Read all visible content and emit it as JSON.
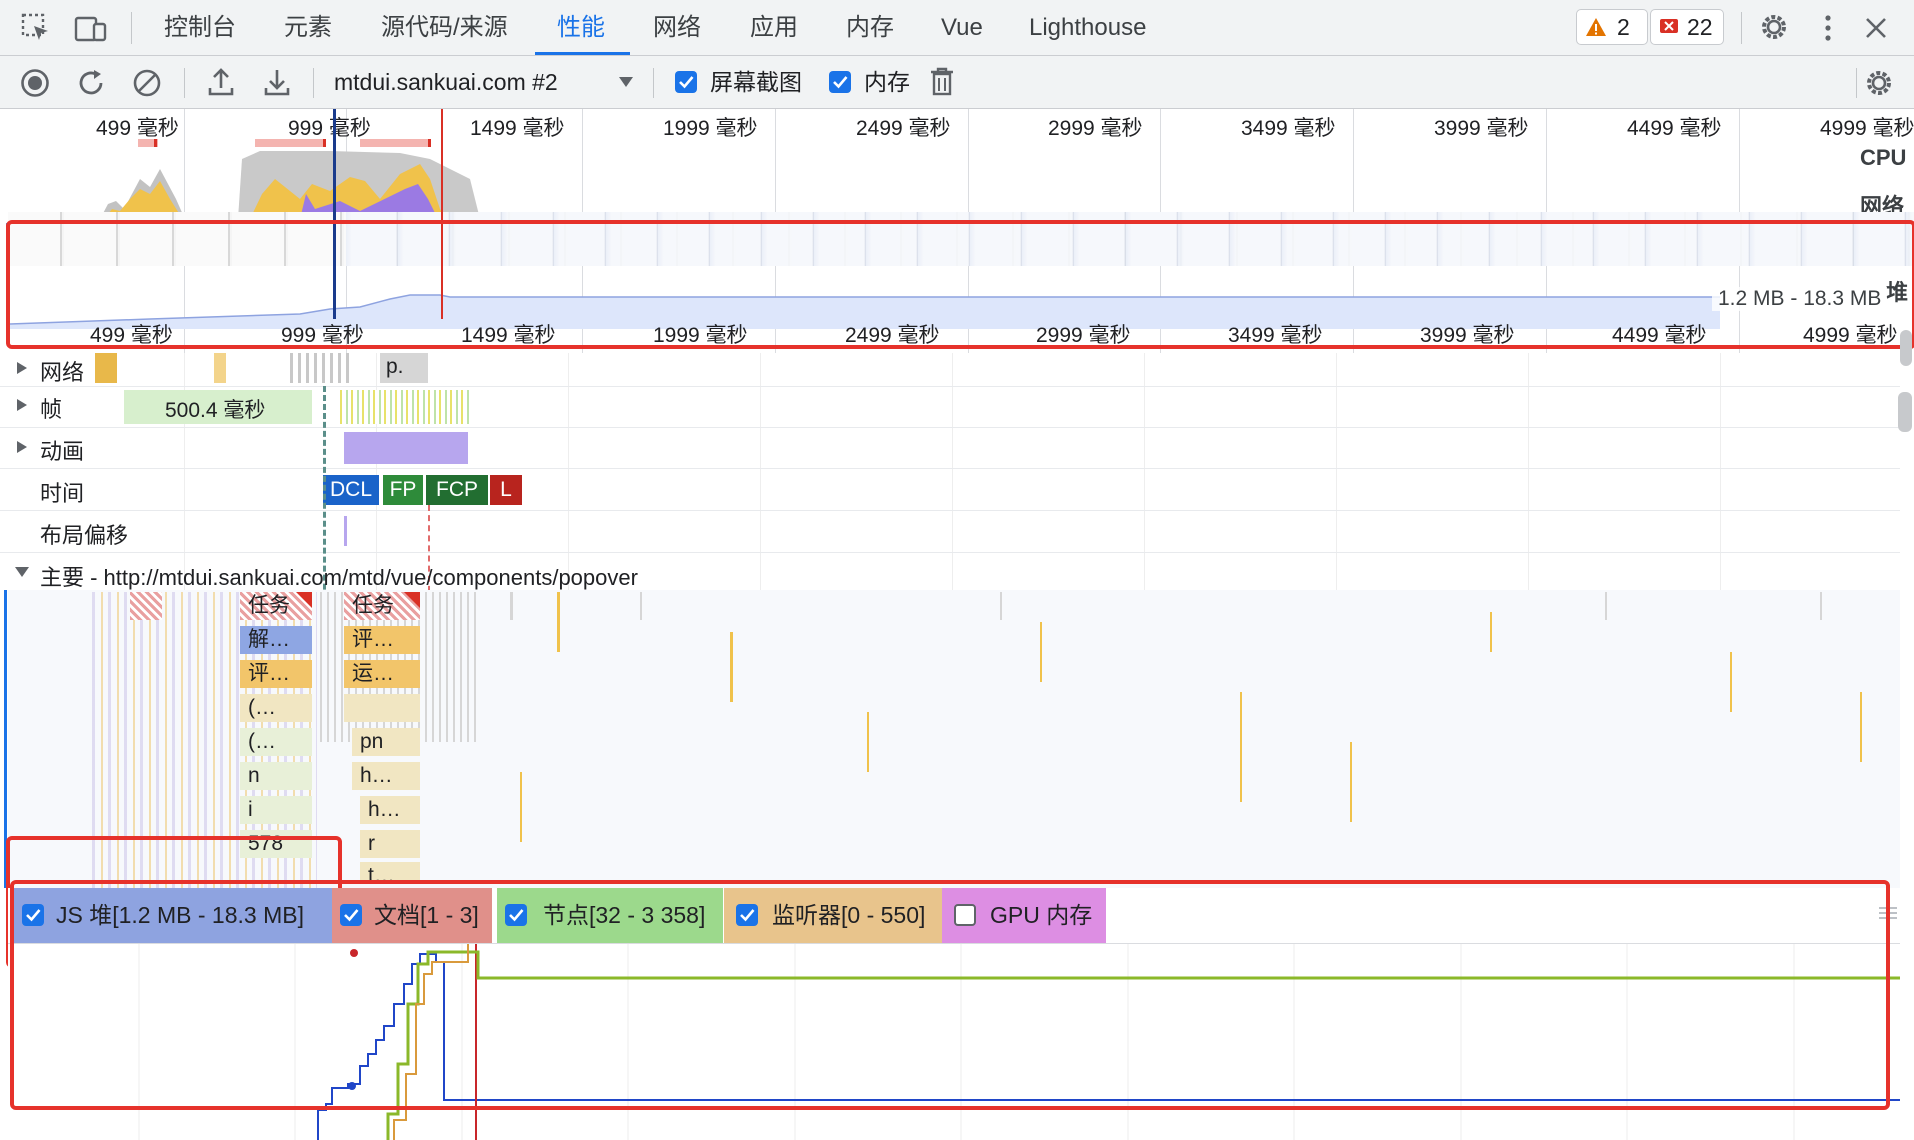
{
  "tabs": {
    "items": [
      {
        "label": "控制台"
      },
      {
        "label": "元素"
      },
      {
        "label": "源代码/来源"
      },
      {
        "label": "性能"
      },
      {
        "label": "网络"
      },
      {
        "label": "应用"
      },
      {
        "label": "内存"
      },
      {
        "label": "Vue"
      },
      {
        "label": "Lighthouse"
      }
    ],
    "active": "性能",
    "warnings_count": "2",
    "errors_count": "22"
  },
  "toolbar": {
    "profile_select_value": "mtdui.sankuai.com #2",
    "screenshots_label": "屏幕截图",
    "screenshots_checked": true,
    "memory_label": "内存",
    "memory_checked": true
  },
  "overview": {
    "top_ticks": [
      "499 毫秒",
      "999 毫秒",
      "1499 毫秒",
      "1999 毫秒",
      "2499 毫秒",
      "2999 毫秒",
      "3499 毫秒",
      "3999 毫秒",
      "4499 毫秒",
      "4999 毫秒"
    ],
    "cpu_label": "CPU",
    "network_label": "网络",
    "heap_label": "堆",
    "heap_range": "1.2 MB - 18.3 MB",
    "bottom_ticks": [
      "499 毫秒",
      "999 毫秒",
      "1499 毫秒",
      "1999 毫秒",
      "2499 毫秒",
      "2999 毫秒",
      "3499 毫秒",
      "3999 毫秒",
      "4499 毫秒",
      "4999 毫秒"
    ]
  },
  "tracks": {
    "network_label": "网络",
    "network_item": "p.",
    "frames_label": "帧",
    "frame_duration": "500.4 毫秒",
    "animation_label": "动画",
    "timings_label": "时间",
    "timings": [
      {
        "label": "DCL",
        "color": "#1a63c9"
      },
      {
        "label": "FP",
        "color": "#2e8b3a"
      },
      {
        "label": "FCP",
        "color": "#226e31"
      },
      {
        "label": "L",
        "color": "#c5221f"
      }
    ],
    "layout_shift_label": "布局偏移",
    "main_label": "主要 - http://mtdui.sankuai.com/mtd/vue/components/popover"
  },
  "flame": {
    "left": [
      "任务",
      "解…",
      "评…",
      "(…",
      "(…",
      "n",
      "i",
      "578"
    ],
    "right": [
      "任务",
      "评…",
      "运…",
      "pn",
      "h…",
      "h…",
      "r",
      "t…"
    ]
  },
  "legend": {
    "items": [
      {
        "label": "JS 堆[1.2 MB - 18.3 MB]",
        "checked": true,
        "color": "#8ea3e0"
      },
      {
        "label": "文档[1 - 3]",
        "checked": true,
        "color": "#e0908a"
      },
      {
        "label": "节点[32 - 3 358]",
        "checked": true,
        "color": "#9cd98c"
      },
      {
        "label": "监听器[0 - 550]",
        "checked": true,
        "color": "#e8c48c"
      },
      {
        "label": "GPU 内存",
        "checked": false,
        "color": "#dd8ee3"
      }
    ]
  },
  "colors": {
    "accent": "#1a73e8",
    "annotation_red": "#e6322b",
    "heap_line": "#2046c8",
    "documents_line": "#c8262a",
    "nodes_line": "#8bb82a",
    "listeners_line": "#d99a3c"
  }
}
